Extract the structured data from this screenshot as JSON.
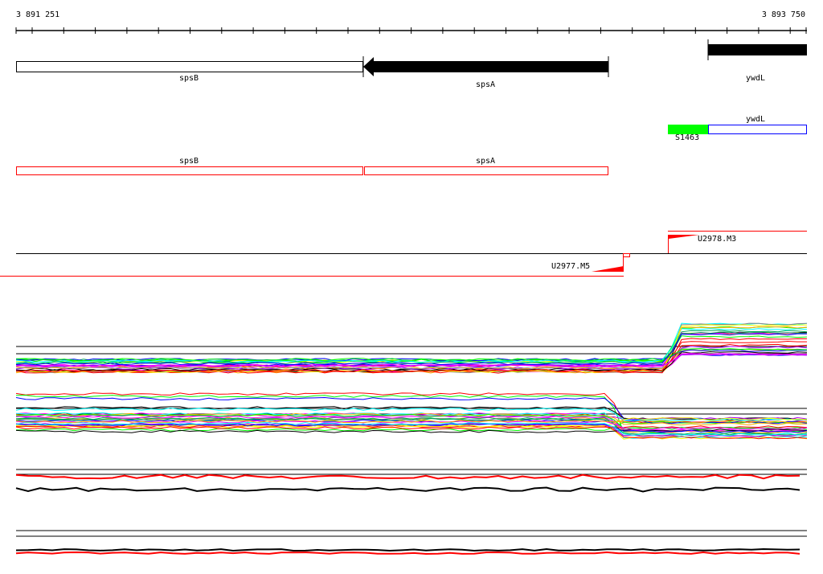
{
  "ruler": {
    "start_label": "3 891 251",
    "end_label": "3 893 750"
  },
  "genes": {
    "spsB": "spsB",
    "spsA": "spsA",
    "ywdL": "ywdL"
  },
  "annotation_track": {
    "ywdL": "ywdL",
    "feature": "S1463"
  },
  "red_track": {
    "spsB": "spsB",
    "spsA": "spsA"
  },
  "transcripts": {
    "upper": "U2978.M3",
    "lower": "U2977.M5"
  },
  "colors": {
    "fill_green": "#00ff00",
    "red": "#ff0000",
    "blue": "#0000ff",
    "black": "#000000"
  }
}
